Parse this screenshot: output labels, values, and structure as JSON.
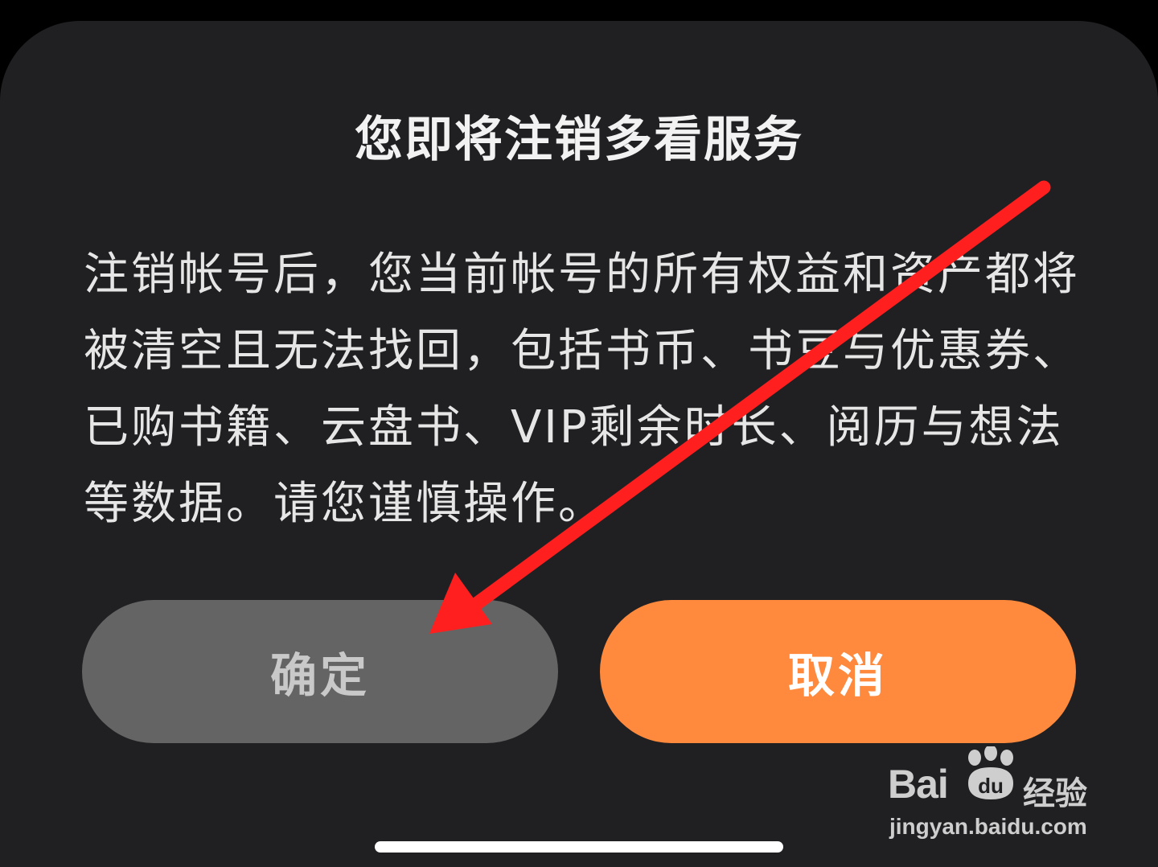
{
  "dialog": {
    "title": "您即将注销多看服务",
    "message": "注销帐号后，您当前帐号的所有权益和资产都将被清空且无法找回，包括书币、书豆与优惠券、已购书籍、云盘书、VIP剩余时长、阅历与想法等数据。请您谨慎操作。",
    "confirm_label": "确定",
    "cancel_label": "取消"
  },
  "watermark": {
    "brand": "Bai",
    "brand_suffix": "经验",
    "url": "jingyan.baidu.com",
    "paw_text": "du"
  },
  "colors": {
    "sheet_background": "#202023",
    "confirm_button": "#646464",
    "cancel_button": "#ff8a3d",
    "annotation_arrow": "#ff1f1f"
  },
  "icons": {
    "annotation": "red-arrow-icon",
    "watermark": "baidu-paw-icon"
  }
}
